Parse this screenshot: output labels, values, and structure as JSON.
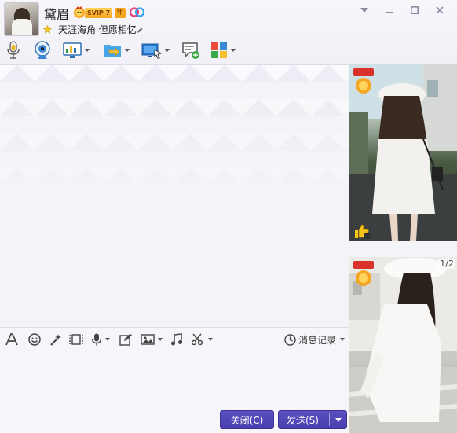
{
  "contact": {
    "name": "黛眉",
    "vip_label": "SVIP 7",
    "year_label": "年",
    "signature": "天涯海角 但愿相忆"
  },
  "window_controls": [
    "chevron-down-icon",
    "minimize-icon",
    "maximize-icon",
    "close-icon"
  ],
  "toolbar_icons": [
    "voice-call-icon",
    "video-call-icon",
    "remote-desktop-icon",
    "file-transfer-icon",
    "screen-share-icon",
    "create-discussion-icon",
    "app-center-icon"
  ],
  "input_toolbar_icons": [
    "font-icon",
    "emoji-icon",
    "magic-icon",
    "screenshot-frame-icon",
    "voice-message-icon",
    "edit-icon",
    "image-icon",
    "music-icon",
    "scissors-icon"
  ],
  "history_label": "消息记录",
  "buttons": {
    "close": "关闭(C)",
    "send": "发送(S)"
  },
  "show_panel": {
    "year_tag_top": "8年",
    "year_tag_bottom": "8年",
    "like_count": "9",
    "page_indicator": "1/2"
  },
  "colors": {
    "accent": "#4a3fae",
    "vip_gold": "#f4a51c",
    "background": "#f4f3f8"
  }
}
